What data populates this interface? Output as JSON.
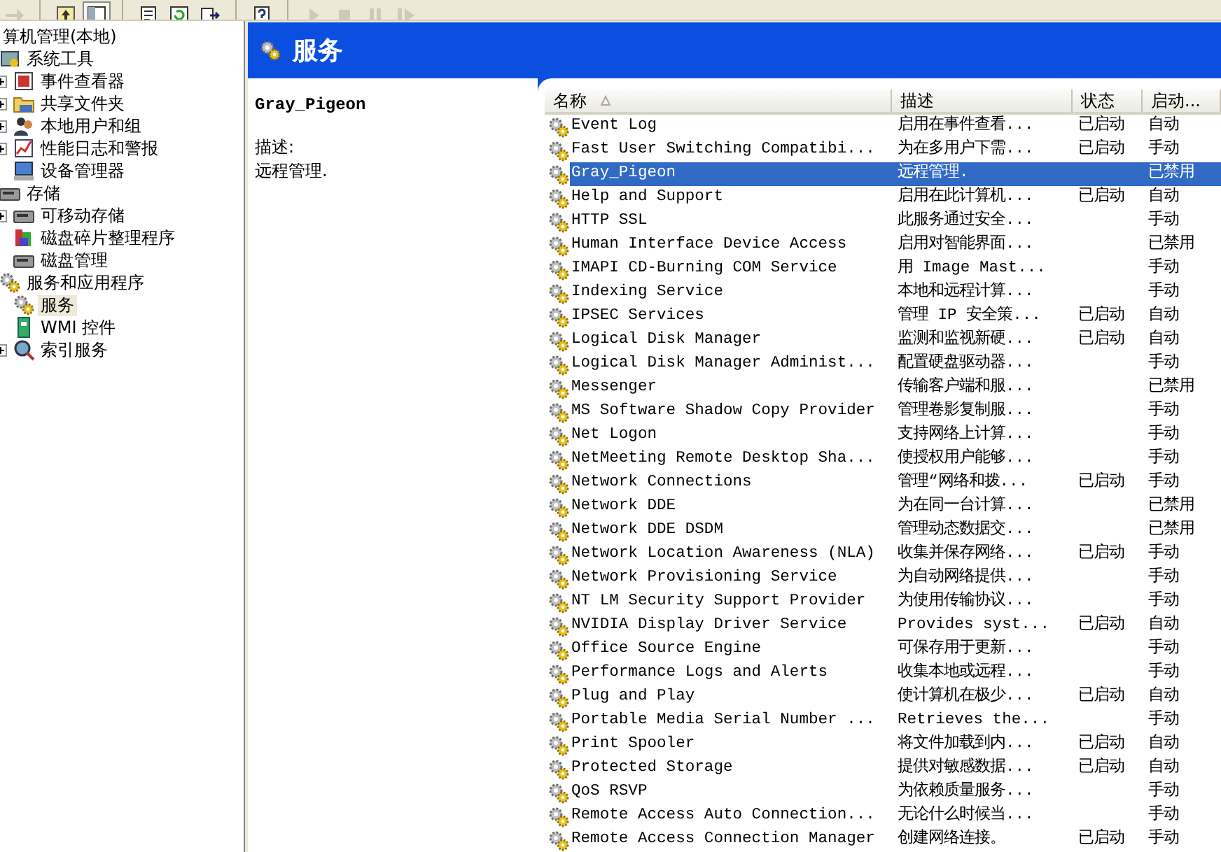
{
  "toolbar": {
    "buttons": [
      {
        "kind": "forward",
        "disabled": true,
        "pressed": false
      },
      {
        "kind": "separator"
      },
      {
        "kind": "up",
        "disabled": false,
        "pressed": false
      },
      {
        "kind": "tree",
        "disabled": false,
        "pressed": true
      },
      {
        "kind": "separator"
      },
      {
        "kind": "properties",
        "disabled": false,
        "pressed": false
      },
      {
        "kind": "refresh",
        "disabled": false,
        "pressed": false
      },
      {
        "kind": "export",
        "disabled": false,
        "pressed": false
      },
      {
        "kind": "separator"
      },
      {
        "kind": "help",
        "disabled": false,
        "pressed": false
      },
      {
        "kind": "separator"
      },
      {
        "kind": "play",
        "disabled": true,
        "pressed": false
      },
      {
        "kind": "stop",
        "disabled": true,
        "pressed": false
      },
      {
        "kind": "pause",
        "disabled": true,
        "pressed": false
      },
      {
        "kind": "restart",
        "disabled": true,
        "pressed": false
      }
    ]
  },
  "tree": {
    "items": [
      {
        "label": "算机管理(本地)",
        "selected": false,
        "children": [
          {
            "label": "系统工具",
            "kind": "tools",
            "selected": false,
            "children": [
              {
                "label": "事件查看器",
                "kind": "log",
                "expanded": false,
                "selected": false
              },
              {
                "label": "共享文件夹",
                "kind": "folder",
                "expanded": false,
                "selected": false
              },
              {
                "label": "本地用户和组",
                "kind": "users",
                "expanded": false,
                "selected": false
              },
              {
                "label": "性能日志和警报",
                "kind": "chart",
                "expanded": false,
                "selected": false
              },
              {
                "label": "设备管理器",
                "kind": "computer",
                "selected": false
              }
            ]
          },
          {
            "label": "存储",
            "kind": "disk",
            "selected": false,
            "children": [
              {
                "label": "可移动存储",
                "kind": "disk",
                "expanded": false,
                "selected": false
              },
              {
                "label": "磁盘碎片整理程序",
                "kind": "defrag",
                "selected": false
              },
              {
                "label": "磁盘管理",
                "kind": "disk",
                "selected": false
              }
            ]
          },
          {
            "label": "服务和应用程序",
            "kind": "gears",
            "selected": false,
            "children": [
              {
                "label": "服务",
                "kind": "gears",
                "selected": true
              },
              {
                "label": "WMI 控件",
                "kind": "wmi",
                "selected": false
              },
              {
                "label": "索引服务",
                "kind": "search",
                "expanded": false,
                "selected": false
              }
            ]
          }
        ]
      }
    ]
  },
  "header": {
    "title": "服务"
  },
  "detail": {
    "name": "Gray_Pigeon",
    "description_label": "描述:",
    "description": "远程管理."
  },
  "table": {
    "columns": [
      {
        "label": "名称",
        "sorted": true
      },
      {
        "label": "描述",
        "sorted": false
      },
      {
        "label": "状态",
        "sorted": false
      },
      {
        "label": "启动...",
        "sorted": false
      }
    ],
    "rows": [
      {
        "name": "Event Log",
        "description": "启用在事件查看...",
        "status": "已启动",
        "startup": "自动",
        "selected": false
      },
      {
        "name": "Fast User Switching Compatibi...",
        "description": "为在多用户下需...",
        "status": "已启动",
        "startup": "手动",
        "selected": false
      },
      {
        "name": "Gray_Pigeon",
        "description": "远程管理.",
        "startup": "已禁用",
        "selected": true
      },
      {
        "name": "Help and Support",
        "description": "启用在此计算机...",
        "status": "已启动",
        "startup": "自动",
        "selected": false
      },
      {
        "name": "HTTP SSL",
        "description": "此服务通过安全...",
        "startup": "手动",
        "selected": false
      },
      {
        "name": "Human Interface Device Access",
        "description": "启用对智能界面...",
        "startup": "已禁用",
        "selected": false
      },
      {
        "name": "IMAPI CD-Burning COM Service",
        "description": "用 Image Mast...",
        "startup": "手动",
        "selected": false
      },
      {
        "name": "Indexing Service",
        "description": "本地和远程计算...",
        "startup": "手动",
        "selected": false
      },
      {
        "name": "IPSEC Services",
        "description": "管理 IP 安全策...",
        "status": "已启动",
        "startup": "自动",
        "selected": false
      },
      {
        "name": "Logical Disk Manager",
        "description": "监测和监视新硬...",
        "status": "已启动",
        "startup": "自动",
        "selected": false
      },
      {
        "name": "Logical Disk Manager Administ...",
        "description": "配置硬盘驱动器...",
        "startup": "手动",
        "selected": false
      },
      {
        "name": "Messenger",
        "description": "传输客户端和服...",
        "startup": "已禁用",
        "selected": false
      },
      {
        "name": "MS Software Shadow Copy Provider",
        "description": "管理卷影复制服...",
        "startup": "手动",
        "selected": false
      },
      {
        "name": "Net Logon",
        "description": "支持网络上计算...",
        "startup": "手动",
        "selected": false
      },
      {
        "name": "NetMeeting Remote Desktop Sha...",
        "description": "使授权用户能够...",
        "startup": "手动",
        "selected": false
      },
      {
        "name": "Network Connections",
        "description": "管理“网络和拨...",
        "status": "已启动",
        "startup": "手动",
        "selected": false
      },
      {
        "name": "Network DDE",
        "description": "为在同一台计算...",
        "startup": "已禁用",
        "selected": false
      },
      {
        "name": "Network DDE DSDM",
        "description": "管理动态数据交...",
        "startup": "已禁用",
        "selected": false
      },
      {
        "name": "Network Location Awareness (NLA)",
        "description": "收集并保存网络...",
        "status": "已启动",
        "startup": "手动",
        "selected": false
      },
      {
        "name": "Network Provisioning Service",
        "description": "为自动网络提供...",
        "startup": "手动",
        "selected": false
      },
      {
        "name": "NT LM Security Support Provider",
        "description": "为使用传输协议...",
        "startup": "手动",
        "selected": false
      },
      {
        "name": "NVIDIA Display Driver Service",
        "description": "Provides syst...",
        "status": "已启动",
        "startup": "自动",
        "selected": false
      },
      {
        "name": "Office Source Engine",
        "description": "可保存用于更新...",
        "startup": "手动",
        "selected": false
      },
      {
        "name": "Performance Logs and Alerts",
        "description": "收集本地或远程...",
        "startup": "手动",
        "selected": false
      },
      {
        "name": "Plug and Play",
        "description": "使计算机在极少...",
        "status": "已启动",
        "startup": "自动",
        "selected": false
      },
      {
        "name": "Portable Media Serial Number ...",
        "description": "Retrieves the...",
        "startup": "手动",
        "selected": false
      },
      {
        "name": "Print Spooler",
        "description": "将文件加载到内...",
        "status": "已启动",
        "startup": "自动",
        "selected": false
      },
      {
        "name": "Protected Storage",
        "description": "提供对敏感数据...",
        "status": "已启动",
        "startup": "自动",
        "selected": false
      },
      {
        "name": "QoS RSVP",
        "description": "为依赖质量服务...",
        "startup": "手动",
        "selected": false
      },
      {
        "name": "Remote Access Auto Connection...",
        "description": "无论什么时候当...",
        "startup": "手动",
        "selected": false
      },
      {
        "name": "Remote Access Connection Manager",
        "description": "创建网络连接。",
        "status": "已启动",
        "startup": "手动",
        "selected": false
      }
    ]
  }
}
